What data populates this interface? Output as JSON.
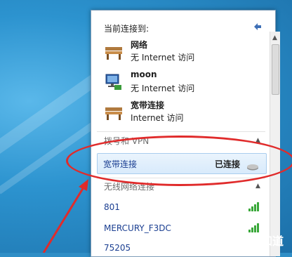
{
  "panel": {
    "current_title": "当前连接到:",
    "networks": [
      {
        "name": "网络",
        "status": "无 Internet 访问",
        "icon": "bench-network-icon"
      },
      {
        "name": "moon",
        "status": "无 Internet 访问",
        "icon": "computer-network-icon"
      },
      {
        "name": "宽带连接",
        "status": "Internet 访问",
        "icon": "bench-network-icon"
      }
    ],
    "dialup_section": "拨号和 VPN",
    "broadband": {
      "name": "宽带连接",
      "state": "已连接"
    },
    "wireless_section": "无线网络连接",
    "wireless": [
      {
        "ssid": "801"
      },
      {
        "ssid": "MERCURY_F3DC"
      },
      {
        "ssid": "75205"
      }
    ]
  },
  "watermark": {
    "text": "百度知道"
  },
  "colors": {
    "accent": "#3d6fb6",
    "highlight": "#e02b2b"
  }
}
